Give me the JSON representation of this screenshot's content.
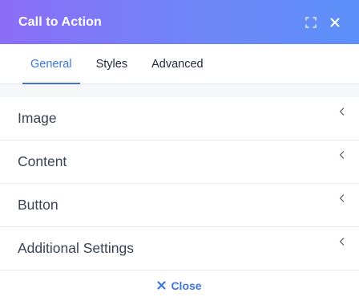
{
  "window": {
    "title": "Call to Action"
  },
  "header": {
    "expand_icon": "expand-icon",
    "close_icon": "close-icon"
  },
  "tabs": [
    {
      "label": "General",
      "active": true
    },
    {
      "label": "Styles",
      "active": false
    },
    {
      "label": "Advanced",
      "active": false
    }
  ],
  "sections": [
    {
      "label": "Image"
    },
    {
      "label": "Content"
    },
    {
      "label": "Button"
    },
    {
      "label": "Additional Settings"
    }
  ],
  "footer": {
    "close_label": "Close"
  },
  "colors": {
    "accent": "#3b76e0",
    "header_start": "#8c6df7",
    "header_end": "#5c90f8"
  }
}
